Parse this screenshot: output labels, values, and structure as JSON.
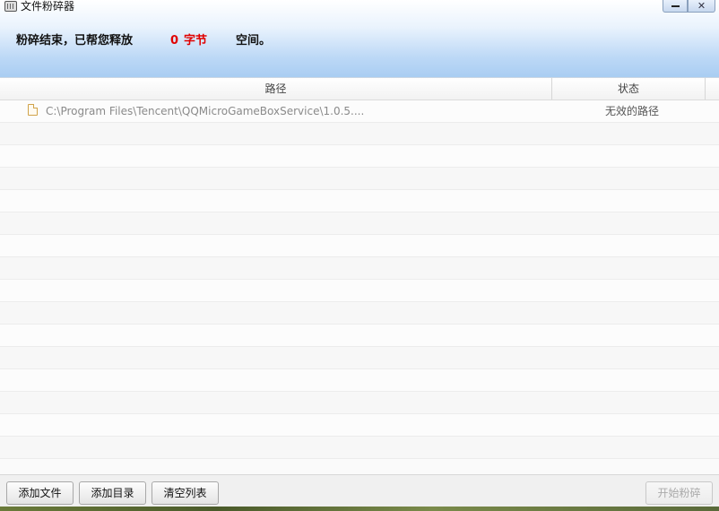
{
  "window": {
    "title": "文件粉碎器",
    "minimize_icon": "minimize-icon",
    "close_icon": "close-icon"
  },
  "summary": {
    "prefix": "粉碎结束，已帮您释放",
    "number": "0",
    "unit": "字节",
    "suffix": "空间。",
    "highlight_color": "#e00000"
  },
  "table": {
    "columns": [
      "路径",
      "状态"
    ],
    "rows": [
      {
        "icon": "file-icon",
        "path": "C:\\Program  Files\\Tencent\\QQMicroGameBoxService\\1.0.5....",
        "status": "无效的路径"
      }
    ]
  },
  "footer": {
    "add_file": "添加文件",
    "add_dir": "添加目录",
    "clear_list": "清空列表",
    "start_shred": "开始粉碎"
  }
}
